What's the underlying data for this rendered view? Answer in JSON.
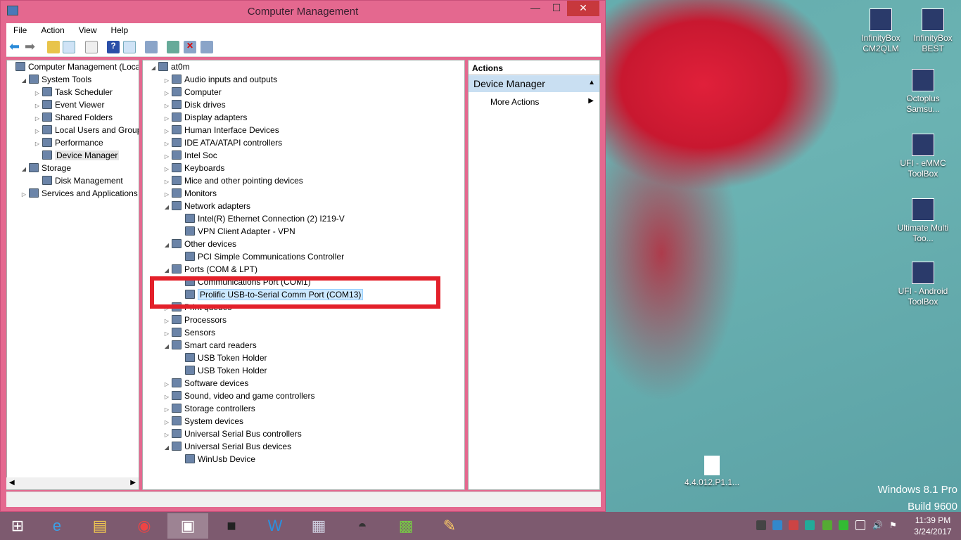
{
  "window": {
    "title": "Computer Management",
    "minimize": "—",
    "maximize": "☐",
    "close": "✕"
  },
  "menu": [
    "File",
    "Action",
    "View",
    "Help"
  ],
  "left_tree": [
    {
      "label": "Computer Management (Local)",
      "level": 0,
      "tw": ""
    },
    {
      "label": "System Tools",
      "level": 1,
      "tw": "◢"
    },
    {
      "label": "Task Scheduler",
      "level": 2,
      "tw": "▷"
    },
    {
      "label": "Event Viewer",
      "level": 2,
      "tw": "▷"
    },
    {
      "label": "Shared Folders",
      "level": 2,
      "tw": "▷"
    },
    {
      "label": "Local Users and Groups",
      "level": 2,
      "tw": "▷"
    },
    {
      "label": "Performance",
      "level": 2,
      "tw": "▷"
    },
    {
      "label": "Device Manager",
      "level": 2,
      "tw": "",
      "selected": true
    },
    {
      "label": "Storage",
      "level": 1,
      "tw": "◢"
    },
    {
      "label": "Disk Management",
      "level": 2,
      "tw": ""
    },
    {
      "label": "Services and Applications",
      "level": 1,
      "tw": "▷"
    }
  ],
  "device_tree": [
    {
      "label": "at0m",
      "level": 0,
      "tw": "◢"
    },
    {
      "label": "Audio inputs and outputs",
      "level": 1,
      "tw": "▷"
    },
    {
      "label": "Computer",
      "level": 1,
      "tw": "▷"
    },
    {
      "label": "Disk drives",
      "level": 1,
      "tw": "▷"
    },
    {
      "label": "Display adapters",
      "level": 1,
      "tw": "▷"
    },
    {
      "label": "Human Interface Devices",
      "level": 1,
      "tw": "▷"
    },
    {
      "label": "IDE ATA/ATAPI controllers",
      "level": 1,
      "tw": "▷"
    },
    {
      "label": "Intel Soc",
      "level": 1,
      "tw": "▷"
    },
    {
      "label": "Keyboards",
      "level": 1,
      "tw": "▷"
    },
    {
      "label": "Mice and other pointing devices",
      "level": 1,
      "tw": "▷"
    },
    {
      "label": "Monitors",
      "level": 1,
      "tw": "▷"
    },
    {
      "label": "Network adapters",
      "level": 1,
      "tw": "◢"
    },
    {
      "label": "Intel(R) Ethernet Connection (2) I219-V",
      "level": 2,
      "tw": ""
    },
    {
      "label": "VPN Client Adapter - VPN",
      "level": 2,
      "tw": ""
    },
    {
      "label": "Other devices",
      "level": 1,
      "tw": "◢"
    },
    {
      "label": "PCI Simple Communications Controller",
      "level": 2,
      "tw": ""
    },
    {
      "label": "Ports (COM & LPT)",
      "level": 1,
      "tw": "◢"
    },
    {
      "label": "Communications Port (COM1)",
      "level": 2,
      "tw": ""
    },
    {
      "label": "Prolific USB-to-Serial Comm Port (COM13)",
      "level": 2,
      "tw": "",
      "selected": true
    },
    {
      "label": "Print queues",
      "level": 1,
      "tw": "▷"
    },
    {
      "label": "Processors",
      "level": 1,
      "tw": "▷"
    },
    {
      "label": "Sensors",
      "level": 1,
      "tw": "▷"
    },
    {
      "label": "Smart card readers",
      "level": 1,
      "tw": "◢"
    },
    {
      "label": "USB Token Holder",
      "level": 2,
      "tw": ""
    },
    {
      "label": "USB Token Holder",
      "level": 2,
      "tw": ""
    },
    {
      "label": "Software devices",
      "level": 1,
      "tw": "▷"
    },
    {
      "label": "Sound, video and game controllers",
      "level": 1,
      "tw": "▷"
    },
    {
      "label": "Storage controllers",
      "level": 1,
      "tw": "▷"
    },
    {
      "label": "System devices",
      "level": 1,
      "tw": "▷"
    },
    {
      "label": "Universal Serial Bus controllers",
      "level": 1,
      "tw": "▷"
    },
    {
      "label": "Universal Serial Bus devices",
      "level": 1,
      "tw": "◢"
    },
    {
      "label": "WinUsb Device",
      "level": 2,
      "tw": ""
    }
  ],
  "actions": {
    "header": "Actions",
    "section": "Device Manager",
    "more": "More Actions"
  },
  "desktop_icons": [
    {
      "label": "InfinityBox CM2QLM"
    },
    {
      "label": "InfinityBox BEST"
    },
    {
      "label": "Octoplus Samsu..."
    },
    {
      "label": "UFI - eMMC ToolBox"
    },
    {
      "label": "Ultimate Multi Too..."
    },
    {
      "label": "UFI - Android ToolBox"
    },
    {
      "label": "4.4.012.P1.1..."
    }
  ],
  "watermark": {
    "line1": "Windows 8.1 Pro",
    "line2": "Build 9600"
  },
  "clock": {
    "time": "11:39 PM",
    "date": "3/24/2017"
  },
  "colors": {
    "titlebar": "#e4688f",
    "highlight": "#e3202a",
    "selection": "#cce8ff"
  }
}
